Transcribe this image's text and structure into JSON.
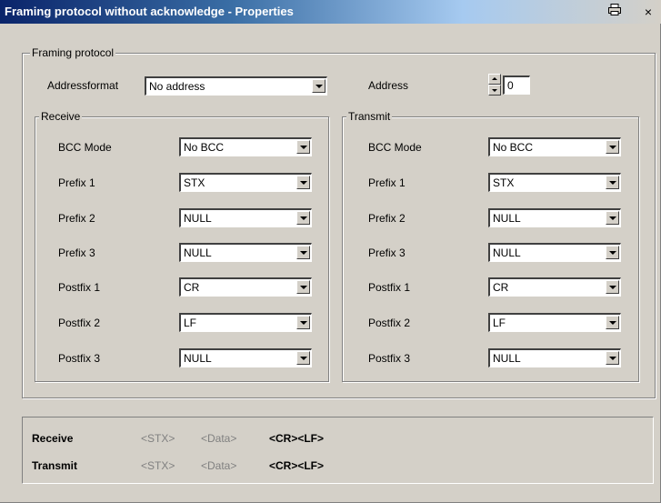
{
  "window": {
    "title": "Framing protocol without acknowledge - Properties",
    "print_icon": "printer-icon",
    "close_label": "×"
  },
  "framing_protocol": {
    "group_label": "Framing protocol",
    "address_format_label": "Addressformat",
    "address_format_value": "No address",
    "address_label": "Address",
    "address_value": "0"
  },
  "receive": {
    "group_label": "Receive",
    "rows": [
      {
        "label": "BCC Mode",
        "value": "No BCC"
      },
      {
        "label": "Prefix 1",
        "value": "STX"
      },
      {
        "label": "Prefix 2",
        "value": "NULL"
      },
      {
        "label": "Prefix 3",
        "value": "NULL"
      },
      {
        "label": "Postfix 1",
        "value": "CR"
      },
      {
        "label": "Postfix 2",
        "value": "LF"
      },
      {
        "label": "Postfix 3",
        "value": "NULL"
      }
    ]
  },
  "transmit": {
    "group_label": "Transmit",
    "rows": [
      {
        "label": "BCC Mode",
        "value": "No BCC"
      },
      {
        "label": "Prefix 1",
        "value": "STX"
      },
      {
        "label": "Prefix 2",
        "value": "NULL"
      },
      {
        "label": "Prefix 3",
        "value": "NULL"
      },
      {
        "label": "Postfix 1",
        "value": "CR"
      },
      {
        "label": "Postfix 2",
        "value": "LF"
      },
      {
        "label": "Postfix 3",
        "value": "NULL"
      }
    ]
  },
  "preview": {
    "receive": {
      "label": "Receive",
      "prefix": "<STX>",
      "data": "<Data>",
      "postfix": "<CR><LF>"
    },
    "transmit": {
      "label": "Transmit",
      "prefix": "<STX>",
      "data": "<Data>",
      "postfix": "<CR><LF>"
    }
  }
}
